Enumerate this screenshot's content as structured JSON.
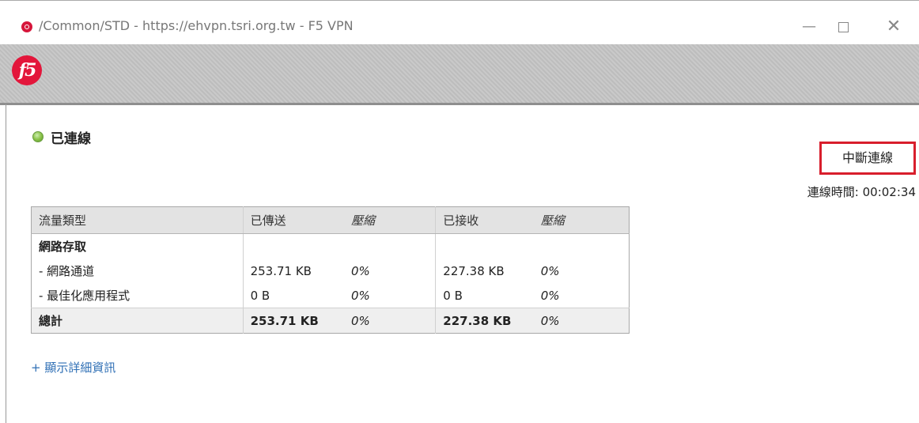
{
  "window": {
    "title": "/Common/STD - https://ehvpn.tsri.org.tw - F5 VPN",
    "minimize": "—",
    "close": "✕"
  },
  "logo": {
    "text": "f5",
    "color": "#e3163b"
  },
  "status": {
    "text": "已連線",
    "color": "#8bc34a"
  },
  "disconnect_button": {
    "label": "中斷連線",
    "border_color": "#d81e2c"
  },
  "connection_time": {
    "label": "連線時間: 00:02:34"
  },
  "table": {
    "headers": [
      "流量類型",
      "已傳送",
      "壓縮",
      "已接收",
      "壓縮"
    ],
    "rows": [
      {
        "type": "網路存取",
        "sent": "",
        "sent_comp": "",
        "recv": "",
        "recv_comp": ""
      },
      {
        "type": "- 網路通道",
        "sent": "253.71 KB",
        "sent_comp": "0%",
        "recv": "227.38 KB",
        "recv_comp": "0%"
      },
      {
        "type": "- 最佳化應用程式",
        "sent": "0 B",
        "sent_comp": "0%",
        "recv": "0 B",
        "recv_comp": "0%"
      }
    ],
    "total": {
      "type": "總計",
      "sent": "253.71 KB",
      "sent_comp": "0%",
      "recv": "227.38 KB",
      "recv_comp": "0%"
    }
  },
  "details_link": {
    "label": "+ 顯示詳細資訊",
    "color": "#2f6fb5"
  }
}
